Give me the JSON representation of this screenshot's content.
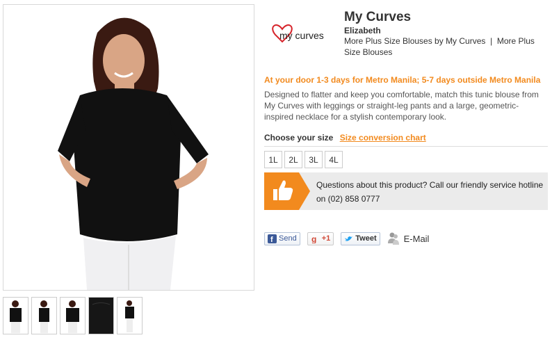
{
  "product": {
    "brand_title": "My Curves",
    "name": "Elizabeth",
    "more_link_1": "More Plus Size Blouses by My Curves",
    "separator": "|",
    "more_link_2": "More Plus Size Blouses"
  },
  "logo": {
    "text": "my curves",
    "accent": "#d6232a"
  },
  "delivery": "At your door 1-3 days for Metro Manila; 5-7 days outside Metro Manila",
  "description": "Designed to flatter and keep you comfortable, match this tunic blouse from My Curves with leggings or straight-leg pants and a large, geometric-inspired necklace for a stylish contemporary look.",
  "size": {
    "label": "Choose your size",
    "chart_link": "Size conversion chart",
    "options": [
      "1L",
      "2L",
      "3L",
      "4L"
    ]
  },
  "hotline": {
    "text": "Questions about this product? Call our friendly service hotline on (02) 858 0777",
    "icon": "thumbs-up-icon",
    "accent": "#f28a1e"
  },
  "share": {
    "facebook": "Send",
    "google": "+1",
    "twitter": "Tweet",
    "email": "E-Mail"
  },
  "colors": {
    "orange": "#f28a1e",
    "blouse": "#111111",
    "pants": "#f2f2f2"
  },
  "thumbnails": 5
}
